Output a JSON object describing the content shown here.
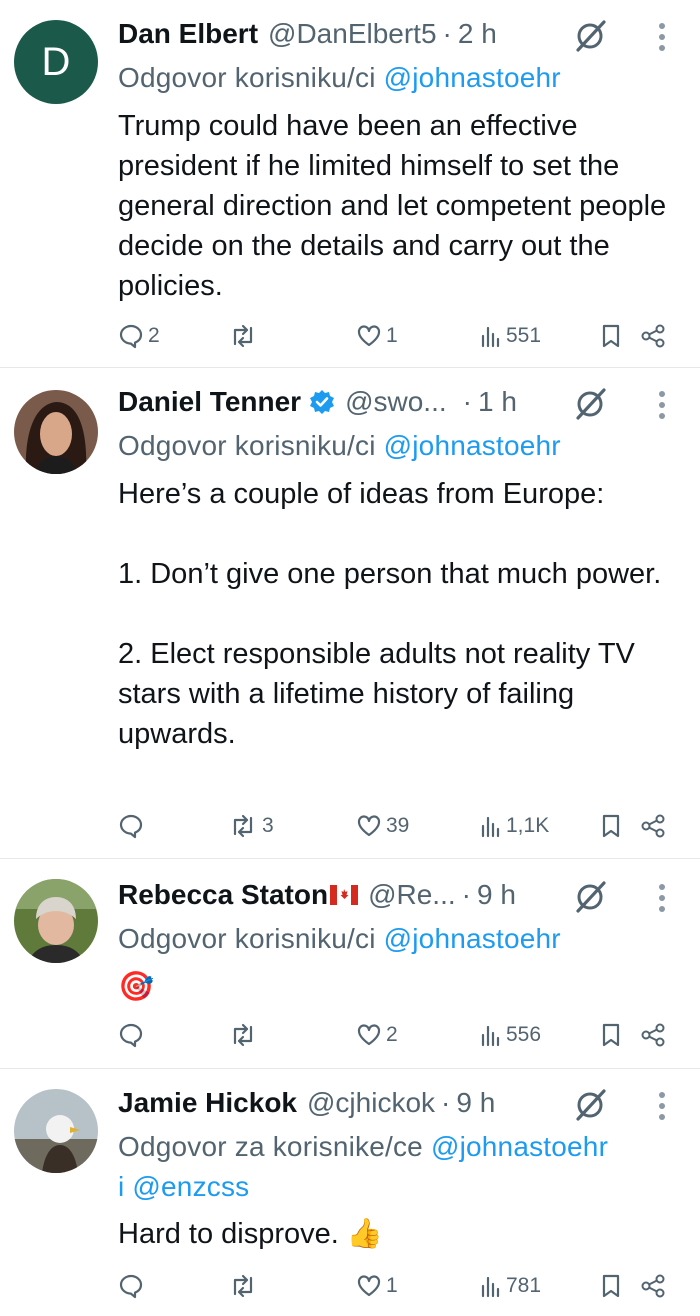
{
  "tweets": [
    {
      "avatar_letter": "D",
      "name": "Dan Elbert",
      "handle": "@DanElbert5",
      "separator": "·",
      "time": "2 h",
      "reply_prefix": "Odgovor korisniku/ci",
      "mentions": [
        "@johnastoehr"
      ],
      "text": "Trump could have been an effective president if he limited himself to set the general direction and let competent people decide on the details and carry out the policies.",
      "stats": {
        "replies": "2",
        "retweets": "",
        "likes": "1",
        "views": "551"
      }
    },
    {
      "name": "Daniel Tenner",
      "handle": "@swo...",
      "separator": "·",
      "time": "1 h",
      "verified": true,
      "reply_prefix": "Odgovor korisniku/ci",
      "mentions": [
        "@johnastoehr"
      ],
      "text": "Here’s a couple of ideas from Europe:\n\n1. Don’t give one person that much power.\n\n2. Elect responsible adults not reality TV stars with a lifetime history of failing upwards.",
      "stats": {
        "replies": "",
        "retweets": "3",
        "likes": "39",
        "views": "1,1K"
      }
    },
    {
      "name": "Rebecca Staton",
      "flag": "canada-flag",
      "handle": "@Re...",
      "separator": "·",
      "time": "9 h",
      "reply_prefix": "Odgovor korisniku/ci",
      "mentions": [
        "@johnastoehr"
      ],
      "text": "🎯",
      "stats": {
        "replies": "",
        "retweets": "",
        "likes": "2",
        "views": "556"
      }
    },
    {
      "name": "Jamie Hickok",
      "handle": "@cjhickok",
      "separator": "·",
      "time": "9 h",
      "reply_prefix": "Odgovor za korisnike/ce",
      "mentions": [
        "@johnastoehr",
        "@enzcss"
      ],
      "mention_joiner": "i",
      "text": "Hard to disprove. 👍",
      "stats": {
        "replies": "",
        "retweets": "",
        "likes": "1",
        "views": "781"
      }
    }
  ],
  "icons": {
    "reply": "reply-icon",
    "retweet": "retweet-icon",
    "like": "heart-icon",
    "views": "views-icon",
    "bookmark": "bookmark-icon",
    "share": "share-icon",
    "grok": "grok-icon",
    "more": "more-icon",
    "verified": "verified-badge-icon"
  },
  "colors": {
    "text": "#0f1419",
    "secondary": "#536471",
    "link": "#1d9bf0",
    "avatar_d": "#1b5a4a"
  }
}
